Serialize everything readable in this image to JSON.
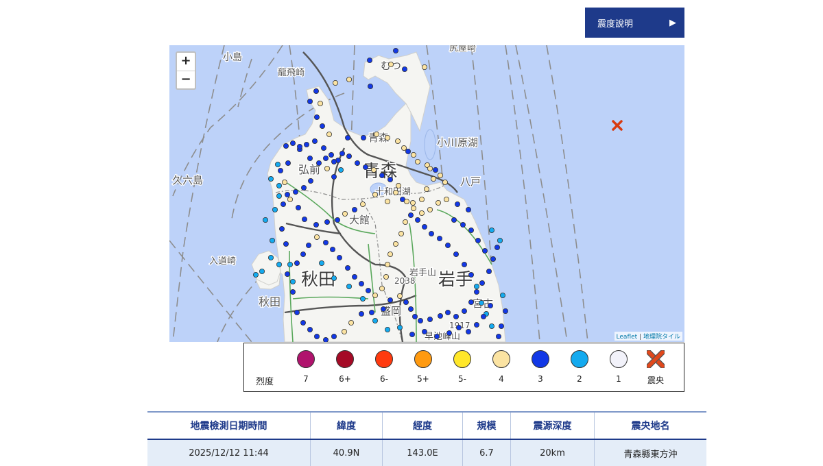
{
  "button": {
    "label": "震度說明",
    "arrow": "▶"
  },
  "map": {
    "zoom_in": "+",
    "zoom_out": "−",
    "attribution": {
      "leaflet": "Leaflet",
      "separator": "|",
      "tiles": "地理院タイル"
    },
    "place_labels": [
      {
        "name": "小島"
      },
      {
        "name": "龍飛崎"
      },
      {
        "name": "むつ"
      },
      {
        "name": "尻屋崎"
      },
      {
        "name": "青森"
      },
      {
        "name": "青森"
      },
      {
        "name": "小川原湖"
      },
      {
        "name": "弘前"
      },
      {
        "name": "久六島"
      },
      {
        "name": "十和田湖"
      },
      {
        "name": "八戸"
      },
      {
        "name": "大館"
      },
      {
        "name": "入道崎"
      },
      {
        "name": "秋田"
      },
      {
        "name": "岩手"
      },
      {
        "name": "秋田"
      },
      {
        "name": "宮古"
      },
      {
        "name": "盛岡"
      },
      {
        "name": "岩手山"
      },
      {
        "name": "2038"
      },
      {
        "name": "1917"
      },
      {
        "name": "早池峰山"
      }
    ],
    "epicenter": {
      "label": "震央",
      "color": "#d83a10"
    }
  },
  "legend": {
    "title": "烈度",
    "items": [
      {
        "label": "7",
        "color": "#b0136d"
      },
      {
        "label": "6+",
        "color": "#a50a26"
      },
      {
        "label": "6-",
        "color": "#ff3a0f"
      },
      {
        "label": "5+",
        "color": "#ff9a10"
      },
      {
        "label": "5-",
        "color": "#ffe72a"
      },
      {
        "label": "4",
        "color": "#fbe3a2"
      },
      {
        "label": "3",
        "color": "#1238e6"
      },
      {
        "label": "2",
        "color": "#14aaef"
      },
      {
        "label": "1",
        "color": "#f2f2fa"
      },
      {
        "label": "震央",
        "color": "#e0481c"
      }
    ]
  },
  "table": {
    "headers": [
      "地震檢測日期時間",
      "緯度",
      "經度",
      "規模",
      "震源深度",
      "震央地名"
    ],
    "row": [
      "2025/12/12 11:44",
      "40.9N",
      "143.0E",
      "6.7",
      "20km",
      "青森縣東方沖"
    ]
  }
}
